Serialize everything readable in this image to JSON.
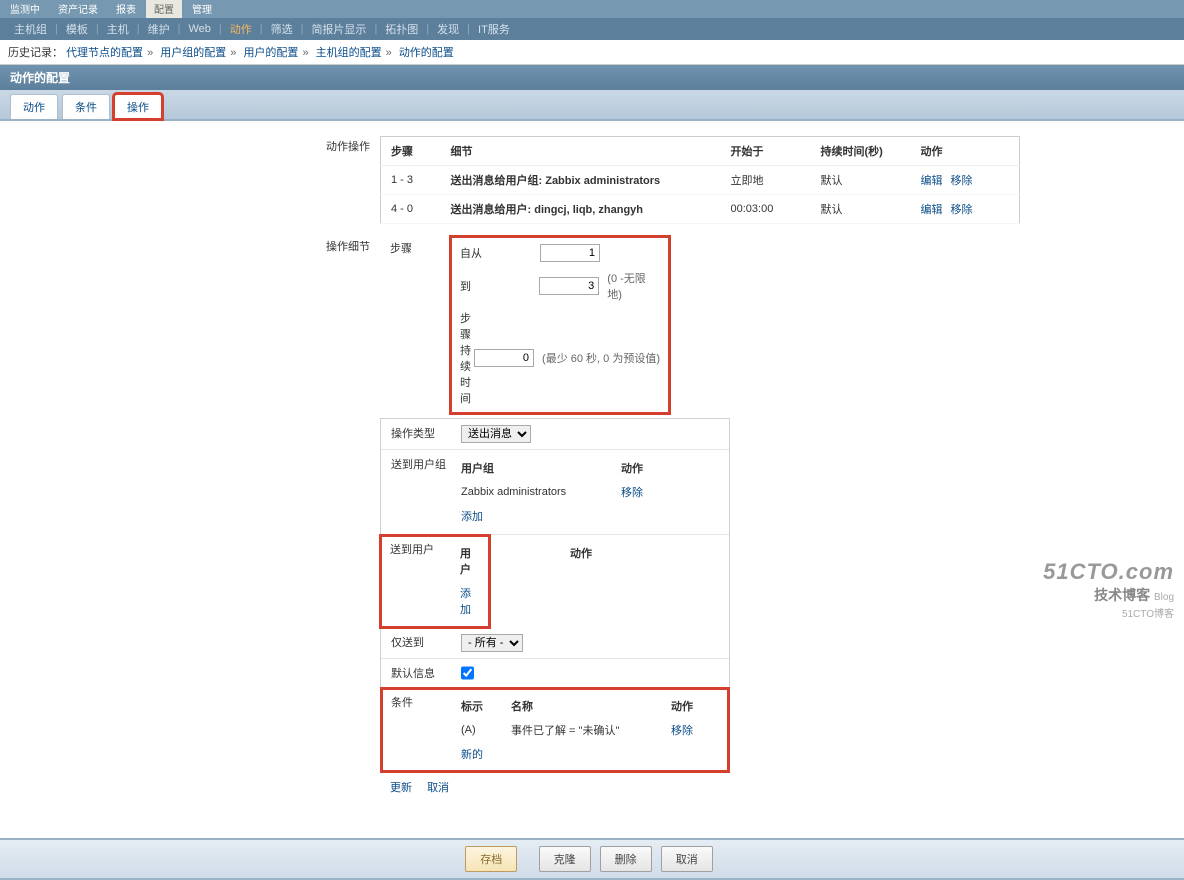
{
  "topTabs": {
    "items": [
      "监测中",
      "资产记录",
      "报表",
      "配置",
      "管理"
    ],
    "active": "配置"
  },
  "subNav": {
    "items": [
      "主机组",
      "模板",
      "主机",
      "维护",
      "Web",
      "动作",
      "筛选",
      "简报片显示",
      "拓扑图",
      "发现",
      "IT服务"
    ],
    "active": "动作"
  },
  "breadcrumb": {
    "label": "历史记录：",
    "items": [
      "代理节点的配置",
      "用户组的配置",
      "用户的配置",
      "主机组的配置",
      "动作的配置"
    ],
    "sep": "»"
  },
  "titleBar": "动作的配置",
  "tabs": {
    "items": [
      "动作",
      "条件",
      "操作"
    ],
    "active": "操作"
  },
  "opsSection": {
    "label": "动作操作",
    "headers": {
      "step": "步骤",
      "detail": "细节",
      "start": "开始于",
      "duration": "持续时间(秒)",
      "action": "动作"
    },
    "rows": [
      {
        "step": "1 - 3",
        "detail": "送出消息给用户组: Zabbix administrators",
        "start": "立即地",
        "duration": "默认",
        "edit": "编辑",
        "remove": "移除"
      },
      {
        "step": "4 - 0",
        "detail": "送出消息给用户: dingcj, liqb, zhangyh",
        "start": "00:03:00",
        "duration": "默认",
        "edit": "编辑",
        "remove": "移除"
      }
    ]
  },
  "detailSection": {
    "label": "操作细节",
    "steps": {
      "label": "步骤",
      "from": {
        "label": "自从",
        "value": "1"
      },
      "to": {
        "label": "到",
        "value": "3",
        "hint": "(0 -无限地)"
      },
      "duration": {
        "label": "步骤持续时间",
        "value": "0",
        "hint": "(最少 60 秒, 0 为预设值)"
      }
    },
    "opType": {
      "label": "操作类型",
      "value": "送出消息"
    },
    "sendToGroup": {
      "label": "送到用户组",
      "headers": {
        "group": "用户组",
        "action": "动作"
      },
      "rows": [
        {
          "name": "Zabbix administrators",
          "remove": "移除"
        }
      ],
      "add": "添加"
    },
    "sendToUser": {
      "label": "送到用户",
      "headers": {
        "user": "用户",
        "action": "动作"
      },
      "add": "添加"
    },
    "onlySend": {
      "label": "仅送到",
      "value": "- 所有 -"
    },
    "defaultMsg": {
      "label": "默认信息",
      "checked": true
    },
    "condition": {
      "label": "条件",
      "headers": {
        "mark": "标示",
        "name": "名称",
        "action": "动作"
      },
      "rows": [
        {
          "mark": "(A)",
          "name": "事件已了解 = \"未确认\"",
          "remove": "移除"
        }
      ],
      "new": "新的"
    },
    "bottomLinks": {
      "update": "更新",
      "cancel": "取消"
    }
  },
  "buttons": {
    "save": "存档",
    "clone": "克隆",
    "delete": "删除",
    "cancel": "取消"
  },
  "watermark": {
    "line1": "51CTO.com",
    "line2": "技术博客",
    "blog": "Blog",
    "sub": "51CTO博客"
  }
}
